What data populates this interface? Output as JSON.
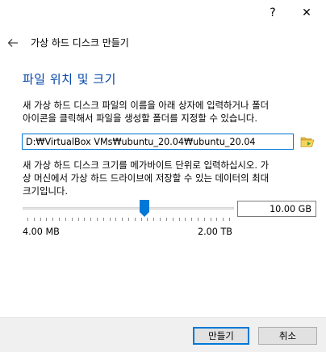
{
  "titlebar": {
    "help_glyph": "?",
    "close_glyph": "✕"
  },
  "header": {
    "title": "가상 하드 디스크 만들기"
  },
  "page": {
    "heading": "파일 위치 및 크기",
    "location_description_line1": "새 가상 하드 디스크 파일의 이름을 아래 상자에 입력하거나 폴더",
    "location_description_line2": "아이콘을 클릭해서 파일을 생성할 폴더를 지정할 수 있습니다.",
    "location_value": "D:₩VirtualBox VMs₩ubuntu_20.04₩ubuntu_20.04",
    "size_description_line1": "새 가상 하드 디스크 크기를 메가바이트 단위로 입력하십시오. 가",
    "size_description_line2": "상 머신에서 가상 하드 드라이브에 저장할 수 있는 데이터의 최대",
    "size_description_line3": "크기입니다.",
    "size_value": "10.00 GB",
    "size_slider_fraction": 0.58,
    "size_min_label": "4.00 MB",
    "size_max_label": "2.00 TB",
    "tick_count": 33
  },
  "footer": {
    "create_label": "만들기",
    "cancel_label": "취소"
  },
  "colors": {
    "accent": "#0078d7",
    "heading": "#0044aa",
    "slider_thumb": "#0078d7",
    "footer_bg": "#f0f0f0"
  },
  "icons": {
    "back": "arrow-left-icon",
    "folder": "open-folder-icon",
    "help": "help-icon",
    "close": "close-icon"
  }
}
